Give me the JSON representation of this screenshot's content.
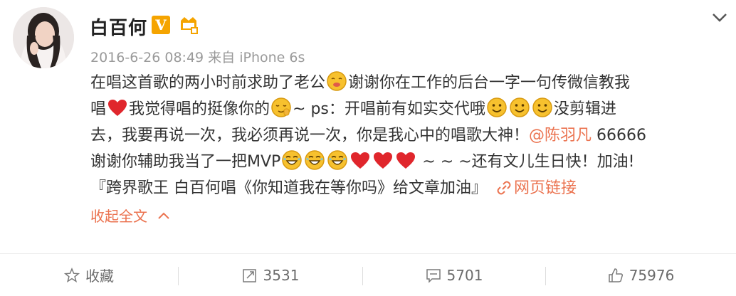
{
  "user": {
    "name": "白百何",
    "vip_badge": "V"
  },
  "post": {
    "timestamp": "2016-6-26 08:49",
    "source": "来自 iPhone 6s",
    "line1_a": "在唱这首歌的两小时前求助了老公",
    "line1_b": "谢谢你在工作的后台一字一句传微信教我",
    "line2_a": "唱",
    "line2_b": "我觉得唱的挺像你的",
    "line2_c": "~ ps：开唱前有如实交代哦",
    "line2_d": "没剪辑进",
    "line3_a": "去，我要再说一次，我必须再说一次，你是我心中的唱歌大神！",
    "mention": "@陈羽凡",
    "line3_b": " 66666",
    "line4_a": "谢谢你辅助我当了一把MVP",
    "line4_b": " ~ ~ ~还有文儿生日快！加油!",
    "quote": "『跨界歌王 白百何唱《你知道我在等你吗》给文章加油』",
    "web_link": "网页链接",
    "collapse": "收起全文"
  },
  "actions": {
    "favorite": "收藏",
    "repost": "3531",
    "comment": "5701",
    "like": "75976"
  },
  "colors": {
    "accent": "#eb7350",
    "vip": "#f5a400",
    "meta": "#9a9a9a"
  },
  "icons": [
    "chevron-down-icon",
    "emoji-icon",
    "heart-icon",
    "link-icon",
    "chevron-up-icon",
    "star-icon",
    "repost-icon",
    "comment-icon",
    "like-icon"
  ]
}
